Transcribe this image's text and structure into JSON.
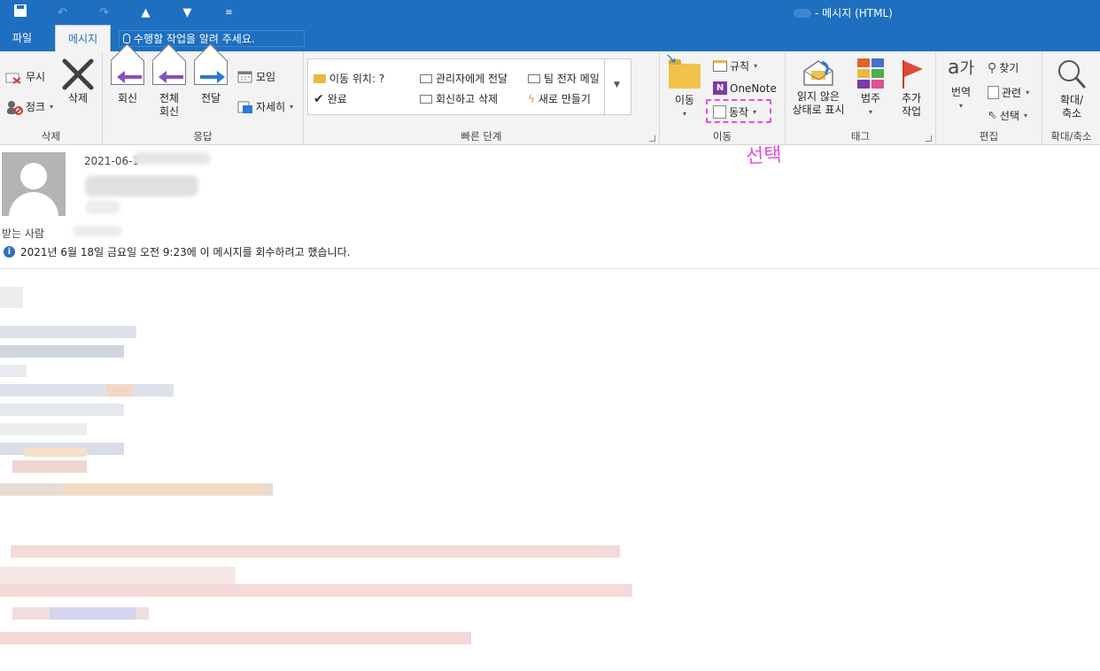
{
  "titlebar": {
    "window_title": "- 메시지 (HTML)",
    "qat": [
      "save-icon",
      "undo-icon",
      "redo-icon",
      "up-arrow-icon",
      "down-arrow-icon",
      "customize-icon"
    ]
  },
  "tabs": {
    "file": "파일",
    "message": "메시지"
  },
  "tell_me": {
    "text": "수행할 작업을 알려 주세요."
  },
  "ribbon": {
    "delete_group": {
      "label": "삭제",
      "ignore": "무시",
      "junk": "정크",
      "delete": "삭제"
    },
    "respond_group": {
      "label": "응답",
      "reply": "회신",
      "reply_all": "전체\n회신",
      "forward": "전달",
      "meeting": "모임",
      "more": "자세히"
    },
    "quick_steps": {
      "label": "빠른 단계",
      "items": [
        "이동 위치: ?",
        "관리자에게 전달",
        "팀 전자 메일",
        "완료",
        "회신하고 삭제",
        "새로 만들기"
      ]
    },
    "move_group": {
      "label": "이동",
      "move": "이동",
      "rules": "규칙",
      "onenote": "OneNote",
      "actions": "동작"
    },
    "tags_group": {
      "label": "태그",
      "mark_unread": "읽지 않은\n상태로 표시",
      "categorize": "범주",
      "follow_up": "추가\n작업"
    },
    "editing_group": {
      "label": "편집",
      "translate": "번역",
      "find": "찾기",
      "related": "관련",
      "select": "선택"
    },
    "zoom_group": {
      "label": "확대/축소",
      "zoom": "확대/\n축소"
    }
  },
  "annotation": {
    "text": "선택"
  },
  "message": {
    "date": "2021-06-1",
    "to_label": "받는 사람",
    "recall_info": "2021년 6월 18일 금요일 오전 9:23에 이 메시지를 회수하려고 했습니다."
  },
  "colors": {
    "accent": "#1e6fc0",
    "annotation": "#e64fe0",
    "ribbon_bg": "#f3f3f3"
  }
}
